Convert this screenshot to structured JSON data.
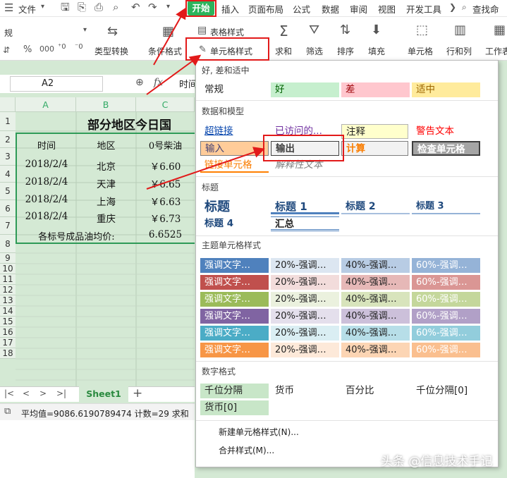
{
  "menubar": {
    "file": "文件",
    "tabs": [
      "开始",
      "插入",
      "页面布局",
      "公式",
      "数据",
      "审阅",
      "视图",
      "开发工具"
    ],
    "search": "查找命"
  },
  "toolbar": {
    "font_name": "规",
    "table_style": "表格样式",
    "cell_style": "单元格样式",
    "type_convert": "类型转换",
    "cond_format": "条件格式",
    "sum": "求和",
    "filter": "筛选",
    "sort": "排序",
    "fill": "填充",
    "cell": "单元格",
    "rowcol": "行和列",
    "worksheet": "工作表"
  },
  "formula": {
    "namebox": "A2",
    "fx": "fx",
    "value": "时间"
  },
  "sheet": {
    "columns": [
      "A",
      "B",
      "C"
    ],
    "rows": [
      "1",
      "2",
      "3",
      "4",
      "5",
      "6",
      "7",
      "8",
      "9",
      "10",
      "11",
      "12",
      "13",
      "14",
      "15",
      "16",
      "17",
      "18"
    ],
    "title": "部分地区今日国",
    "header": [
      "时间",
      "地区",
      "0号柴油"
    ],
    "data": [
      [
        "2018/2/4",
        "北京",
        "￥6.60"
      ],
      [
        "2018/2/4",
        "天津",
        "￥6.65"
      ],
      [
        "2018/2/4",
        "上海",
        "￥6.63"
      ],
      [
        "2018/2/4",
        "重庆",
        "￥6.73"
      ]
    ],
    "avg_label": "各标号成品油均价:",
    "avg_value": "6.6525"
  },
  "tabbar": {
    "sheet": "Sheet1",
    "add": "+"
  },
  "status": {
    "text": "平均值=9086.6190789474  计数=29  求和"
  },
  "panel": {
    "sections": [
      "好, 差和适中",
      "数据和模型",
      "标题",
      "主题单元格样式",
      "数字格式"
    ],
    "good_bad": [
      "常规",
      "好",
      "差",
      "适中"
    ],
    "data_model_r1": [
      "超链接",
      "已访问的...",
      "注释",
      "警告文本"
    ],
    "data_model_r2": [
      "输入",
      "输出",
      "计算",
      "检查单元格"
    ],
    "data_model_r3": [
      "链接单元格",
      "解释性文本"
    ],
    "titles": [
      "标题",
      "标题 1",
      "标题 2",
      "标题 3",
      "标题 4",
      "汇总"
    ],
    "theme_labels": [
      "强调文字…",
      "20%-强调…",
      "40%-强调…",
      "60%-强调…"
    ],
    "number": [
      "千位分隔",
      "货币",
      "百分比",
      "千位分隔[0]",
      "货币[0]"
    ],
    "new_style": "新建单元格样式(N)...",
    "merge_style": "合并样式(M)..."
  },
  "theme_colors": {
    "row_colors": [
      "#4f81bd",
      "#c0504d",
      "#9bbb59",
      "#8064a2",
      "#4bacc6",
      "#f79646"
    ],
    "tint20": [
      "#dce6f1",
      "#f2dcdb",
      "#ebf1de",
      "#e4dfec",
      "#daeef3",
      "#fde9d9"
    ],
    "tint40": [
      "#b8cce4",
      "#e6b8b7",
      "#d8e4bc",
      "#ccc0da",
      "#b7dee8",
      "#fcd5b4"
    ],
    "tint60": [
      "#95b3d7",
      "#da9694",
      "#c4d79b",
      "#b1a0c7",
      "#92cddc",
      "#fabf8f"
    ]
  },
  "watermark": "头条 @信息技术手记"
}
